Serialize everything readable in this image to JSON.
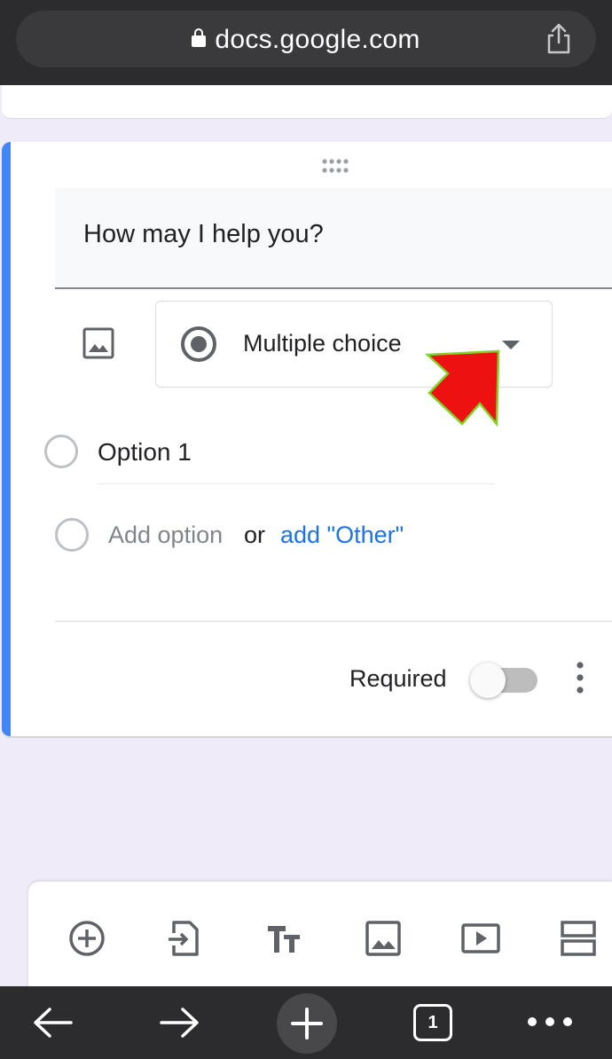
{
  "browser": {
    "url": "docs.google.com",
    "tab_count": "1"
  },
  "question": {
    "title": "How may I help you?",
    "type": "Multiple choice",
    "options": [
      "Option 1"
    ],
    "add_option": "Add option",
    "or_text": "or",
    "add_other": "add \"Other\"",
    "required_label": "Required",
    "required_on": false
  },
  "toolbar": {
    "tools": [
      "add-question-icon",
      "import-questions-icon",
      "add-title-icon",
      "add-image-icon",
      "add-video-icon",
      "add-section-icon"
    ]
  },
  "colors": {
    "accent": "#4285f4",
    "link": "#1a73e8",
    "annotation_arrow": "#ee1111",
    "annotation_outline": "#7ed321"
  }
}
